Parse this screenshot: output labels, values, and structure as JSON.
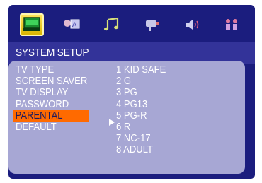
{
  "icons": [
    "system-setup-icon",
    "language-setup-icon",
    "audio-setup-icon",
    "video-setup-icon",
    "speaker-setup-icon",
    "preference-setup-icon"
  ],
  "header": {
    "title": "SYSTEM SETUP"
  },
  "menu": {
    "items": [
      {
        "label": "TV TYPE"
      },
      {
        "label": "SCREEN SAVER"
      },
      {
        "label": "TV DISPLAY"
      },
      {
        "label": "PASSWORD"
      },
      {
        "label": "PARENTAL"
      },
      {
        "label": "DEFAULT"
      }
    ],
    "selected_label": "PARENTAL"
  },
  "options": {
    "items": [
      {
        "label": "1 KID SAFE"
      },
      {
        "label": "2 G"
      },
      {
        "label": "3 PG"
      },
      {
        "label": "4 PG13"
      },
      {
        "label": "5 PG-R"
      },
      {
        "label": "6 R"
      },
      {
        "label": "7 NC-17"
      },
      {
        "label": "8 ADULT"
      }
    ],
    "highlighted_label": "5 PG-R"
  },
  "colors": {
    "frame": "#1b1d7e",
    "header": "#333399",
    "panel": "#a7a7d4",
    "selected_bg": "#ff6a00",
    "active_tab": "#ffe45a"
  }
}
